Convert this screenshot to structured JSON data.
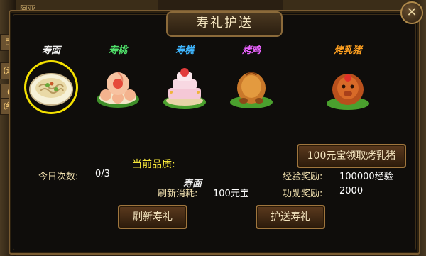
{
  "window": {
    "title": "寿礼护送",
    "close_glyph": "✕"
  },
  "background": {
    "left_tabs": [
      "目",
      "(进",
      "(",
      "(经"
    ],
    "top_left_text": "阿亚",
    "top_right_text": ""
  },
  "items": [
    {
      "label": "寿面",
      "color": "#f0f0f0",
      "icon": "noodle-bowl-icon",
      "selected": true
    },
    {
      "label": "寿桃",
      "color": "#4fe06a",
      "icon": "longevity-peach-icon",
      "selected": false
    },
    {
      "label": "寿糕",
      "color": "#3fb6ff",
      "icon": "birthday-cake-icon",
      "selected": false
    },
    {
      "label": "烤鸡",
      "color": "#ea63ff",
      "icon": "roast-chicken-icon",
      "selected": false
    },
    {
      "label": "烤乳猪",
      "color": "#ffa020",
      "icon": "roast-pig-icon",
      "selected": false
    }
  ],
  "quality": {
    "label": "当前品质:",
    "current": "寿面"
  },
  "buy_button": {
    "label": "100元宝领取烤乳猪"
  },
  "stats": {
    "today_label": "今日次数:",
    "today_value": "0/3",
    "refresh_cost_label": "刷新消耗:",
    "refresh_cost_value": "100元宝",
    "exp_label": "经验奖励:",
    "exp_value": "100000经验",
    "merit_label": "功勋奖励:",
    "merit_value": "2000"
  },
  "buttons": {
    "refresh": "刷新寿礼",
    "escort": "护送寿礼"
  }
}
